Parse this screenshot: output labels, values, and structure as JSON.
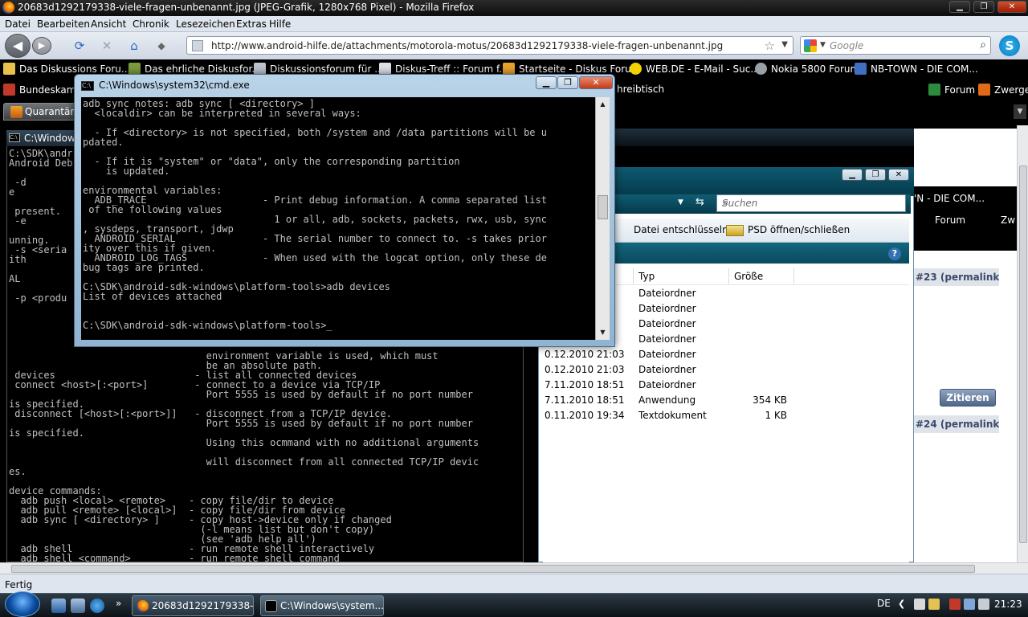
{
  "firefox": {
    "title": "20683d1292179338-viele-fragen-unbenannt.jpg (JPEG-Grafik, 1280x768 Pixel) - Mozilla Firefox",
    "menu": [
      "Datei",
      "Bearbeiten",
      "Ansicht",
      "Chronik",
      "Lesezeichen",
      "Extras",
      "Hilfe"
    ],
    "url": "http://www.android-hilfe.de/attachments/motorola-motus/20683d1292179338-viele-fragen-unbenannt.jpg",
    "search_placeholder": "Google",
    "bookmarks": [
      "Das Diskussions Foru...",
      "Das ehrliche Diskusfor...",
      "Diskussionsforum für ...",
      "Diskus-Treff :: Forum f...",
      "Startseite - Diskus Foru...",
      "WEB.DE - E-Mail - Suc...",
      "Nokia 5800 Forum",
      "NB-TOWN - DIE COM..."
    ],
    "bookmarks2": [
      "Bundeskamp",
      "hreibtisch",
      "Forum",
      "Zwerge"
    ],
    "tab": "Quarantäne",
    "status": "Fertig"
  },
  "bg_console": {
    "title": "C:\\Windows",
    "text": "C:\\SDK\\andr\nAndroid Deb\n\n -d\ne\n\n present.\n -e\n\nunning.\n -s <seria\nith\n\nAL\n\n -p <produ\n\n\n\n\n\n                                  environment variable is used, which must\n                                  be an absolute path.\n devices                        - list all connected devices\n connect <host>[:<port>]        - connect to a device via TCP/IP\n                                  Port 5555 is used by default if no port number\nis specified.\n disconnect [<host>[:<port>]]   - disconnect from a TCP/IP device.\n                                  Port 5555 is used by default if no port number\nis specified.\n                                  Using this ocmmand with no additional arguments\n\n                                  will disconnect from all connected TCP/IP devic\nes.\n\ndevice commands:\n  adb push <local> <remote>    - copy file/dir to device\n  adb pull <remote> [<local>]  - copy file/dir from device\n  adb sync [ <directory> ]     - copy host->device only if changed\n                                 (-l means list but don't copy)\n                                 (see 'adb help all')\n  adb shell                    - run remote shell interactively\n  adb shell <command>          - run remote shell command"
  },
  "cmd": {
    "title": "C:\\Windows\\system32\\cmd.exe",
    "text": "adb sync notes: adb sync [ <directory> ]\n  <localdir> can be interpreted in several ways:\n\n  - If <directory> is not specified, both /system and /data partitions will be u\npdated.\n\n  - If it is \"system\" or \"data\", only the corresponding partition\n    is updated.\n\nenvironmental variables:\n  ADB_TRACE                    - Print debug information. A comma separated list\n of the following values\n                                 1 or all, adb, sockets, packets, rwx, usb, sync\n, sysdeps, transport, jdwp\n  ANDROID_SERIAL               - The serial number to connect to. -s takes prior\nity over this if given.\n  ANDROID_LOG_TAGS             - When used with the logcat option, only these de\nbug tags are printed.\n\nC:\\SDK\\android-sdk-windows\\platform-tools>adb devices\nList of devices attached\n\n\nC:\\SDK\\android-sdk-windows\\platform-tools>_"
  },
  "explorer": {
    "search_placeholder": "Suchen",
    "toolbar": [
      "Datei entschlüsseln",
      "PSD öffnen/schließen"
    ],
    "columns": [
      "Typ",
      "Größe"
    ],
    "rows": [
      {
        "date": "",
        "type": "Dateiordner",
        "size": ""
      },
      {
        "date": "",
        "type": "Dateiordner",
        "size": ""
      },
      {
        "date": "",
        "type": "Dateiordner",
        "size": ""
      },
      {
        "date": "",
        "type": "Dateiordner",
        "size": ""
      },
      {
        "date": "0.12.2010 21:03",
        "type": "Dateiordner",
        "size": ""
      },
      {
        "date": "0.12.2010 21:03",
        "type": "Dateiordner",
        "size": ""
      },
      {
        "date": "7.11.2010 18:51",
        "type": "Dateiordner",
        "size": ""
      },
      {
        "date": "7.11.2010 18:51",
        "type": "Anwendung",
        "size": "354 KB"
      },
      {
        "date": "0.11.2010 19:34",
        "type": "Textdokument",
        "size": "1 KB"
      }
    ]
  },
  "forum": {
    "title_fragment": "'N - DIE COM...",
    "links": [
      "Forum",
      "Zw"
    ],
    "permalink1": "#23 (permalink)",
    "permalink2": "#24 (permalink)",
    "quote_button": "Zitieren"
  },
  "taskbar": {
    "buttons": [
      "20683d1292179338-...",
      "C:\\Windows\\system..."
    ],
    "lang": "DE",
    "time": "21:23"
  }
}
